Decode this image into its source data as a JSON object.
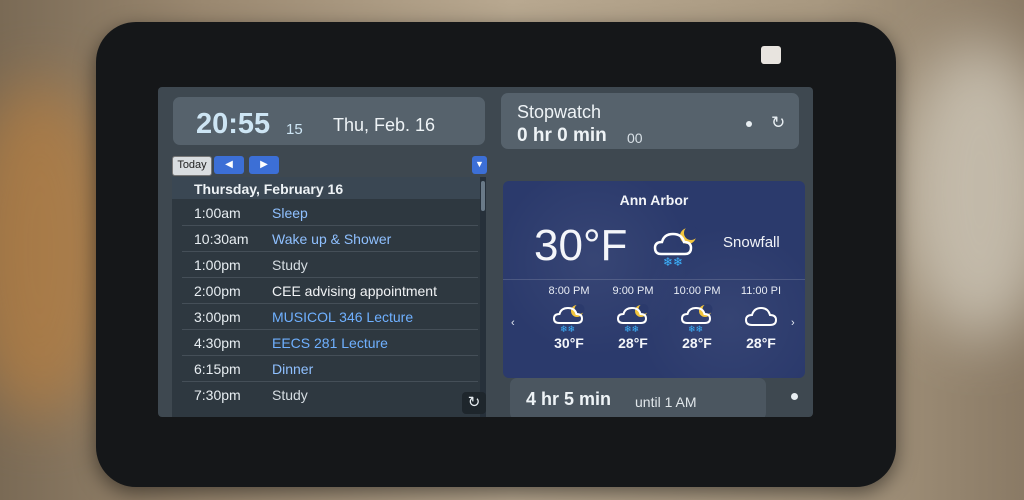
{
  "clock": {
    "time": "20:55",
    "seconds": "15",
    "date": "Thu, Feb. 16"
  },
  "calendar": {
    "today_label": "Today",
    "prev_glyph": "◀",
    "next_glyph": "▶",
    "dropdown_glyph": "▼",
    "day_header": "Thursday, February 16",
    "events": [
      {
        "time": "1:00am",
        "title": "Sleep",
        "color": "#8fc0ff"
      },
      {
        "time": "10:30am",
        "title": "Wake up & Shower",
        "color": "#8fc0ff"
      },
      {
        "time": "1:00pm",
        "title": "Study",
        "color": "#d6dde2"
      },
      {
        "time": "2:00pm",
        "title": "CEE advising appointment",
        "color": "#f2f4f6"
      },
      {
        "time": "3:00pm",
        "title": "MUSICOL 346 Lecture",
        "color": "#6fb0ff"
      },
      {
        "time": "4:30pm",
        "title": "EECS 281 Lecture",
        "color": "#6fb0ff"
      },
      {
        "time": "6:15pm",
        "title": "Dinner",
        "color": "#8fc0ff"
      },
      {
        "time": "7:30pm",
        "title": "Study",
        "color": "#d6dde2"
      }
    ],
    "refresh_glyph": "↻"
  },
  "stopwatch": {
    "title": "Stopwatch",
    "value": "0 hr 0 min",
    "sub": "00",
    "refresh_glyph": "↻"
  },
  "weather": {
    "city": "Ann Arbor",
    "temp": "30°F",
    "condition": "Snowfall",
    "current_icon": "snow-night-icon",
    "hourly": [
      {
        "time": "8:00 PM",
        "temp": "30°F",
        "icon": "snow-night-icon"
      },
      {
        "time": "9:00 PM",
        "temp": "28°F",
        "icon": "snow-night-icon"
      },
      {
        "time": "10:00 PM",
        "temp": "28°F",
        "icon": "snow-night-icon"
      },
      {
        "time": "11:00 PI",
        "temp": "28°F",
        "icon": "cloud-icon"
      }
    ],
    "left_arrow": "‹",
    "right_arrow": "›"
  },
  "timer": {
    "value": "4 hr 5 min",
    "sub": "until 1 AM"
  }
}
